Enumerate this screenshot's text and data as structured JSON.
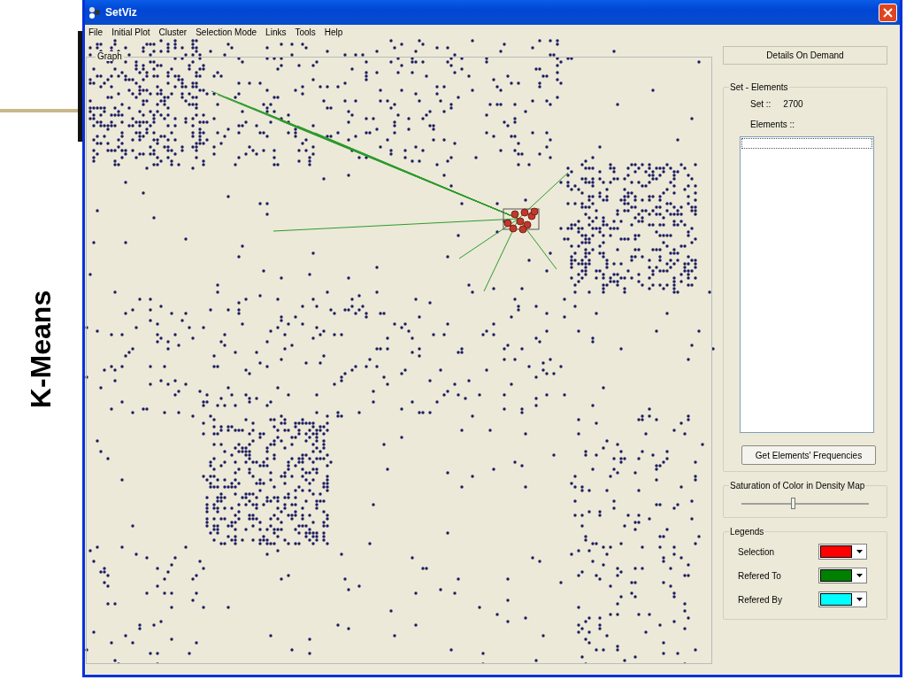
{
  "slide": {
    "title": "K-Means"
  },
  "window": {
    "title": "SetViz"
  },
  "menu": [
    "File",
    "Initial Plot",
    "Cluster",
    "Selection Mode",
    "Links",
    "Tools",
    "Help"
  ],
  "graph": {
    "label": "Graph"
  },
  "details_button": "Details On Demand",
  "set_elements": {
    "label": "Set - Elements",
    "set_label": "Set ::",
    "set_value": "2700",
    "elements_label": "Elements ::",
    "button": "Get Elements' Frequencies"
  },
  "saturation": {
    "label": "Saturation of Color in Density Map",
    "level": 0.41
  },
  "legends": {
    "label": "Legends",
    "items": [
      {
        "name": "Selection",
        "color": "#ff0000"
      },
      {
        "name": "Refered To",
        "color": "#008000"
      },
      {
        "name": "Refered By",
        "color": "#00ffff"
      }
    ]
  }
}
